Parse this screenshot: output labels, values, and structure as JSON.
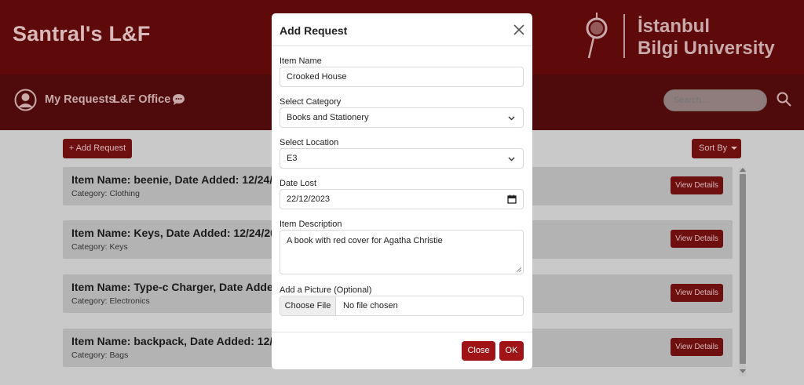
{
  "header": {
    "brand": "Santral's L&F",
    "university_line1": "İstanbul",
    "university_line2": "Bilgi University"
  },
  "nav": {
    "my_requests": "My Requests",
    "lf_office": "L&F Office",
    "search_placeholder": "Search..."
  },
  "toolbar": {
    "add_request": "+ Add Request",
    "sort_by": "Sort By"
  },
  "cards": [
    {
      "title": "Item Name: beenie, Date Added: 12/24/2023",
      "category": "Category: Clothing",
      "button": "View Details"
    },
    {
      "title": "Item Name: Keys, Date Added: 12/24/2023",
      "category": "Category: Keys",
      "button": "View Details"
    },
    {
      "title": "Item Name: Type-c Charger, Date Added: 12/24/2023",
      "category": "Category: Electronics",
      "button": "View Details"
    },
    {
      "title": "Item Name: backpack, Date Added: 12/24/2023",
      "category": "Category: Bags",
      "button": "View Details"
    }
  ],
  "modal": {
    "title": "Add Request",
    "item_name_label": "Item Name",
    "item_name_value": "Crooked House",
    "category_label": "Select Category",
    "category_value": "Books and Stationery",
    "location_label": "Select Location",
    "location_value": "E3",
    "date_label": "Date Lost",
    "date_value": "22/12/2023",
    "description_label": "Item Description",
    "description_value": "A book with red cover for Agatha Christie",
    "picture_label": "Add a Picture (Optional)",
    "choose_file": "Choose File",
    "no_file": "No file chosen",
    "close_button": "Close",
    "ok_button": "OK"
  },
  "colors": {
    "brand_red": "#a01417",
    "header_bg": "#5e0a0a",
    "nav_bg": "#4f0b0b"
  }
}
